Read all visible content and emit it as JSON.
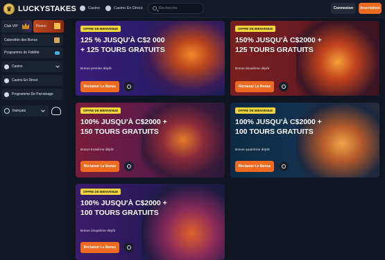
{
  "header": {
    "logo_text": "LUCKYSTAKES",
    "nav": [
      {
        "label": "Casino",
        "icon": "cherry-icon"
      },
      {
        "label": "Casino En Direct",
        "icon": "live-icon"
      }
    ],
    "search_placeholder": "Recherche",
    "login_label": "Connexion",
    "register_label": "Inscription"
  },
  "sidebar": {
    "vip_label": "Club VIP",
    "promo_label": "Promo",
    "items": [
      {
        "label": "Calendrier des Bonus"
      },
      {
        "label": "Programme de Fidélité"
      },
      {
        "label": "Casino"
      },
      {
        "label": "Casino En Direct"
      },
      {
        "label": "Programme De Parrainage"
      }
    ],
    "language": "français"
  },
  "cards": [
    {
      "badge": "OFFRE DE BIENVENUE",
      "title": "125 % JUSQU'À C$2 000 + 125 TOURS GRATUITS",
      "subtitle": "Bonus premier dépôt",
      "button": "Réclamer Le Bonus"
    },
    {
      "badge": "OFFRE DE BIENVENUE",
      "title": "150% JUSQU'À C$2000 + 125 TOURS GRATUITS",
      "subtitle": "Bonus deuxième dépôt",
      "button": "Réclamer Le Bonus"
    },
    {
      "badge": "OFFRE DE BIENVENUE",
      "title": "100% JUSQU'À C$2000 + 150 TOURS GRATUITS",
      "subtitle": "Bonus troisième dépôt",
      "button": "Réclamer Le Bonus"
    },
    {
      "badge": "OFFRE DE BIENVENUE",
      "title": "100% JUSQU'À C$2000 + 100 TOURS GRATUITS",
      "subtitle": "Bonus quatrième dépôt",
      "button": "Réclamer Le Bonus"
    },
    {
      "badge": "OFFRE DE BIENVENUE",
      "title": "100% JUSQU'À C$2000 + 100 TOURS GRATUITS",
      "subtitle": "Bonus cinquième dépôt",
      "button": "Réclamer Le Bonus"
    }
  ],
  "colors": {
    "accent": "#ef6a21",
    "badge": "#f3d63b",
    "background": "#101621"
  }
}
